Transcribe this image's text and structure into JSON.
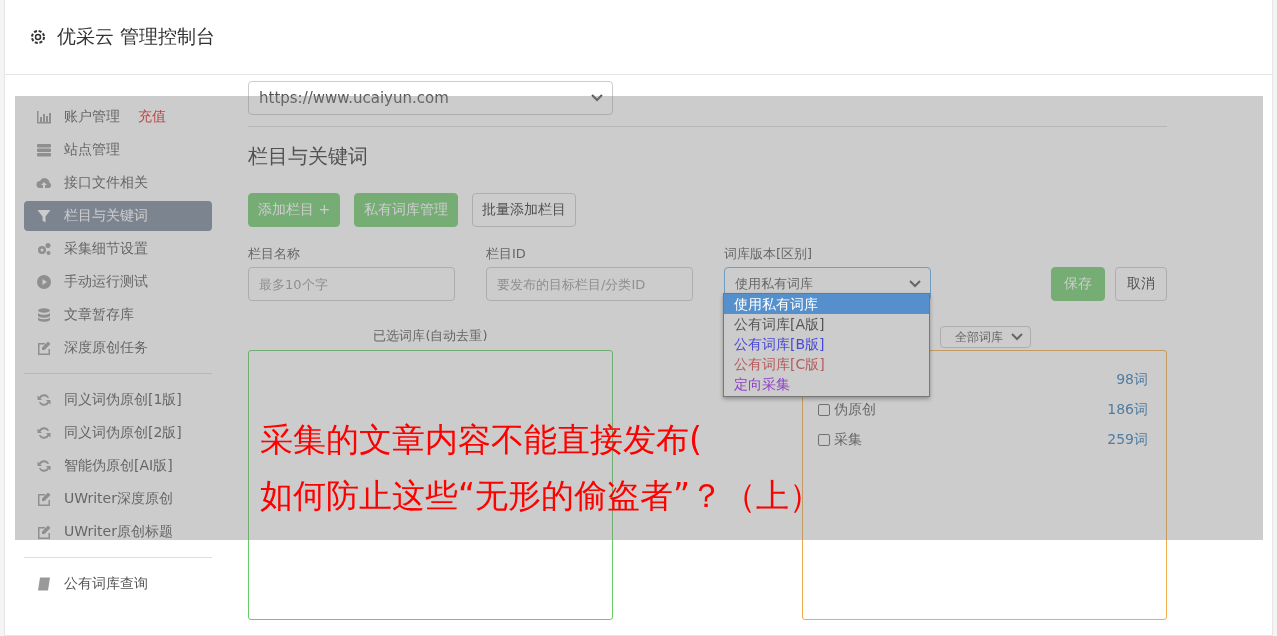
{
  "header": {
    "title": "优采云 管理控制台"
  },
  "sidebar": {
    "sections": [
      {
        "items": [
          {
            "label": "账户管理",
            "badge": "充值",
            "selected": false
          },
          {
            "label": "站点管理",
            "selected": false
          },
          {
            "label": "接口文件相关",
            "selected": false
          },
          {
            "label": "栏目与关键词",
            "selected": true
          },
          {
            "label": "采集细节设置",
            "selected": false
          },
          {
            "label": "手动运行测试",
            "selected": false
          },
          {
            "label": "文章暂存库",
            "selected": false
          },
          {
            "label": "深度原创任务",
            "selected": false
          }
        ]
      },
      {
        "items": [
          {
            "label": "同义词伪原创[1版]",
            "selected": false
          },
          {
            "label": "同义词伪原创[2版]",
            "selected": false
          },
          {
            "label": "智能伪原创[AI版]",
            "selected": false
          },
          {
            "label": "UWriter深度原创",
            "selected": false
          },
          {
            "label": "UWriter原创标题",
            "selected": false
          }
        ]
      },
      {
        "items": [
          {
            "label": "公有词库查询",
            "selected": false
          }
        ]
      }
    ]
  },
  "site_select": {
    "value": "https://www.ucaiyun.com"
  },
  "heading": "栏目与关键词",
  "buttons": [
    {
      "label": "添加栏目 +",
      "kind": "primary"
    },
    {
      "label": "私有词库管理",
      "kind": "primary"
    },
    {
      "label": "批量添加栏目",
      "kind": "default"
    }
  ],
  "form": {
    "name_field": {
      "label": "栏目名称",
      "placeholder": "最多10个字"
    },
    "id_field": {
      "label": "栏目ID",
      "placeholder": "要发布的目标栏目/分类ID"
    },
    "version_select": {
      "label": "词库版本[区别]",
      "value": "使用私有词库",
      "expanded": true,
      "options": [
        {
          "label": "使用私有词库",
          "selected": true,
          "color": "#ffffff"
        },
        {
          "label": "公有词库[A版]",
          "selected": false,
          "color": "#555555"
        },
        {
          "label": "公有词库[B版]",
          "selected": false,
          "color": "#4848d8"
        },
        {
          "label": "公有词库[C版]",
          "selected": false,
          "color": "#b85a5a"
        },
        {
          "label": "定向采集",
          "selected": false,
          "color": "#9040c8"
        }
      ]
    },
    "save_button": "保存",
    "cancel_button": "取消"
  },
  "selected_library": {
    "title": "已选词库(自动去重)"
  },
  "library_list": {
    "filter_value": "全部词库",
    "rows": [
      {
        "count": "98词"
      },
      {
        "label": "伪原创",
        "checked": false,
        "count": "186词"
      },
      {
        "label": "采集",
        "checked": false,
        "count": "259词"
      }
    ]
  },
  "caption": [
    "采集的文章内容不能直接发布(",
    "如何防止这些“无形的偷盗者”？（上）"
  ]
}
